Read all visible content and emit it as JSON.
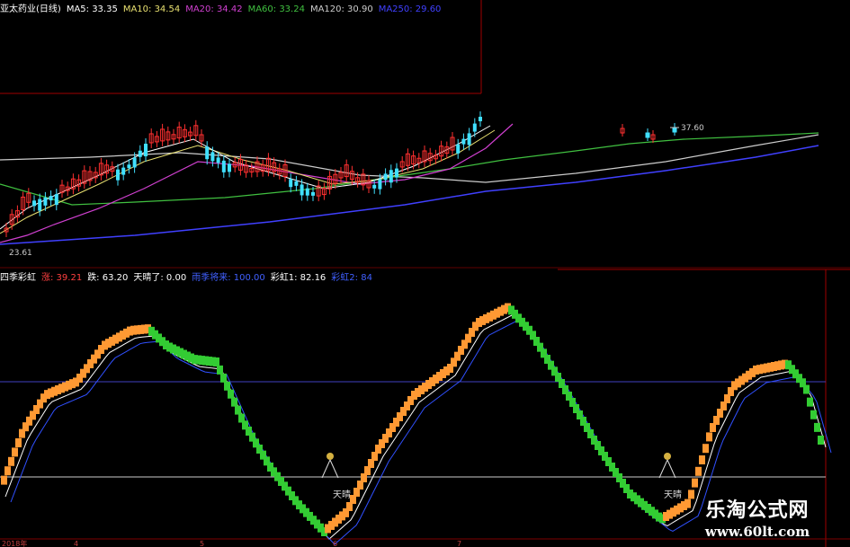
{
  "top_legend": {
    "title": "亚太药业(日线)",
    "items": [
      {
        "text": "MA5: 33.35",
        "color": "#ffffff"
      },
      {
        "text": "MA10: 34.54",
        "color": "#e8e070"
      },
      {
        "text": "MA20: 34.42",
        "color": "#d040d0"
      },
      {
        "text": "MA60: 33.24",
        "color": "#40c040"
      },
      {
        "text": "MA120: 30.90",
        "color": "#cccccc"
      },
      {
        "text": "MA250: 29.60",
        "color": "#4040ff"
      }
    ]
  },
  "bottom_legend": {
    "title": "四季彩虹",
    "items": [
      {
        "text": "涨: 39.21",
        "color": "#ff4040"
      },
      {
        "text": "跌: 63.20",
        "color": "#ffffff"
      },
      {
        "text": "天晴了: 0.00",
        "color": "#ffffff"
      },
      {
        "text": "雨季将来: 100.00",
        "color": "#4060ff"
      },
      {
        "text": "彩虹1: 82.16",
        "color": "#ffffff"
      },
      {
        "text": "彩虹2: 84",
        "color": "#4060ff"
      }
    ]
  },
  "price_labels": {
    "low": "23.61",
    "high": "37.60"
  },
  "signal_labels": {
    "label1": "天晴",
    "label2": "天晴"
  },
  "date_labels": {
    "year": "2018年",
    "m1": "4",
    "m2": "5",
    "m3": "6",
    "m4": "7"
  },
  "watermark": {
    "cn": "乐淘公式网",
    "url": "www.60lt.com"
  },
  "colors": {
    "up_candle": "#ff3030",
    "down_candle": "#40e0ff",
    "rainbow_up": "#ff9933",
    "rainbow_down": "#33cc33",
    "divider": "#a00000",
    "level_line": "#4040c0"
  }
}
